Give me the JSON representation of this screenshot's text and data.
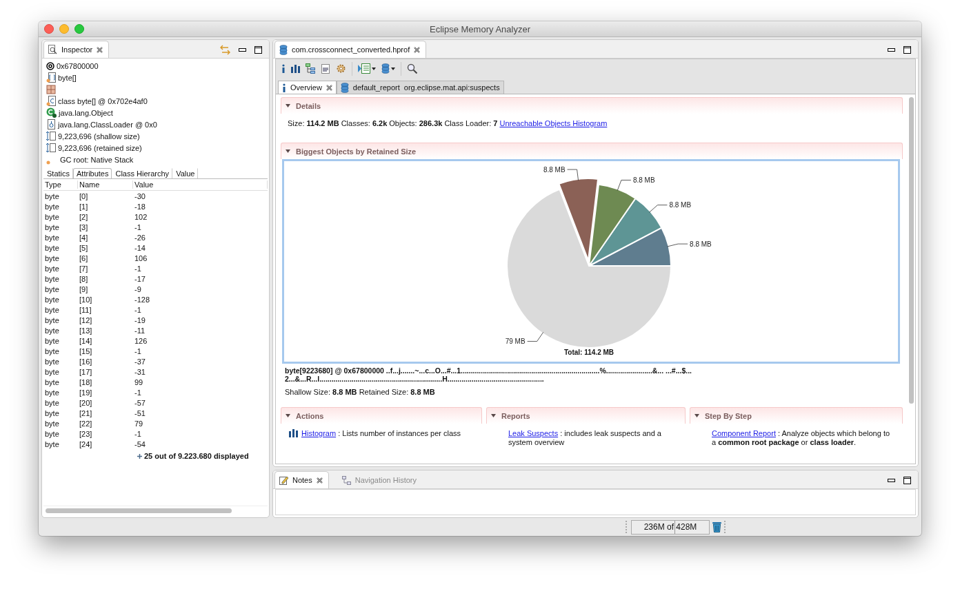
{
  "window": {
    "title": "Eclipse Memory Analyzer"
  },
  "inspector": {
    "tab": "Inspector",
    "info": [
      {
        "kind": "address",
        "text": "0x67800000"
      },
      {
        "kind": "array",
        "text": "byte[]"
      },
      {
        "kind": "grid"
      },
      {
        "kind": "class",
        "text": "class byte[] @ 0x702e4af0"
      },
      {
        "kind": "superclass",
        "text": "java.lang.Object"
      },
      {
        "kind": "classloader",
        "text": "java.lang.ClassLoader @ 0x0"
      },
      {
        "kind": "size",
        "text": "9,223,696 (shallow size)"
      },
      {
        "kind": "size",
        "text": "9,223,696 (retained size)"
      },
      {
        "kind": "gcroot",
        "text": "GC root: Native Stack"
      }
    ],
    "subtabs": [
      {
        "label": "Statics",
        "selected": false
      },
      {
        "label": "Attributes",
        "selected": true
      },
      {
        "label": "Class Hierarchy",
        "selected": false
      },
      {
        "label": "Value",
        "selected": false
      }
    ],
    "columns": [
      "Type",
      "Name",
      "Value"
    ],
    "rows": [
      [
        "byte",
        "[0]",
        "-30"
      ],
      [
        "byte",
        "[1]",
        "-18"
      ],
      [
        "byte",
        "[2]",
        "102"
      ],
      [
        "byte",
        "[3]",
        "-1"
      ],
      [
        "byte",
        "[4]",
        "-26"
      ],
      [
        "byte",
        "[5]",
        "-14"
      ],
      [
        "byte",
        "[6]",
        "106"
      ],
      [
        "byte",
        "[7]",
        "-1"
      ],
      [
        "byte",
        "[8]",
        "-17"
      ],
      [
        "byte",
        "[9]",
        "-9"
      ],
      [
        "byte",
        "[10]",
        "-128"
      ],
      [
        "byte",
        "[11]",
        "-1"
      ],
      [
        "byte",
        "[12]",
        "-19"
      ],
      [
        "byte",
        "[13]",
        "-11"
      ],
      [
        "byte",
        "[14]",
        "126"
      ],
      [
        "byte",
        "[15]",
        "-1"
      ],
      [
        "byte",
        "[16]",
        "-37"
      ],
      [
        "byte",
        "[17]",
        "-31"
      ],
      [
        "byte",
        "[18]",
        "99"
      ],
      [
        "byte",
        "[19]",
        "-1"
      ],
      [
        "byte",
        "[20]",
        "-57"
      ],
      [
        "byte",
        "[21]",
        "-51"
      ],
      [
        "byte",
        "[22]",
        "79"
      ],
      [
        "byte",
        "[23]",
        "-1"
      ],
      [
        "byte",
        "[24]",
        "-54"
      ]
    ],
    "footer": "25 out of 9.223.680 displayed"
  },
  "editor": {
    "tab": "com.crossconnect_converted.hprof",
    "inner_tabs": [
      {
        "kind": "overview",
        "label": "Overview",
        "selected": true
      },
      {
        "kind": "report",
        "label": "default_report  org.eclipse.mat.api:suspects",
        "selected": false
      }
    ],
    "details": {
      "title": "Details",
      "stats": [
        {
          "label": "Size:",
          "value": "114.2 MB"
        },
        {
          "label": "Classes:",
          "value": "6.2k"
        },
        {
          "label": "Objects:",
          "value": "286.3k"
        },
        {
          "label": "Class Loader:",
          "value": "7"
        }
      ],
      "link": "Unreachable Objects Histogram"
    },
    "biggest": {
      "title": "Biggest Objects by Retained Size",
      "chart_data": {
        "type": "pie",
        "values": [
          8.8,
          8.8,
          8.8,
          8.8,
          79
        ],
        "colors": [
          "#5f7d8f",
          "#5e9595",
          "#6e8a52",
          "#8b6156",
          "#dadada"
        ],
        "value_labels": [
          "8.8 MB",
          "8.8 MB",
          "8.8 MB",
          "8.8 MB",
          "79 MB"
        ]
      },
      "total": "Total: 114.2 MB",
      "object_lines": [
        "byte[9223680] @ 0x67800000 ..f...j.......~...c...O...#...1.....................................................................%.......................&... ...#...$...",
        "2...&...R...l.............................................................H................................................"
      ],
      "sizes": [
        {
          "label": "Shallow Size:",
          "value": "8.8 MB"
        },
        {
          "label": "Retained Size:",
          "value": "8.8 MB"
        }
      ]
    },
    "sections": [
      {
        "title": "Actions",
        "entries": [
          {
            "kind": "histogram",
            "link": "Histogram",
            "text": ": Lists number of instances per class"
          }
        ]
      },
      {
        "title": "Reports",
        "entries": [
          {
            "kind": "plain",
            "link": "Leak Suspects",
            "text": ": includes leak suspects and a system overview"
          }
        ]
      },
      {
        "title": "Step By Step",
        "entries": [
          {
            "kind": "plain",
            "link": "Component Report",
            "text": ": Analyze objects which belong to a **common root package** or **class loader**."
          }
        ]
      }
    ]
  },
  "bottom": {
    "tabs": [
      {
        "kind": "notes",
        "label": "Notes",
        "selected": true
      },
      {
        "kind": "history",
        "label": "Navigation History",
        "selected": false
      }
    ]
  },
  "status": {
    "heap": "236M of 428M"
  }
}
